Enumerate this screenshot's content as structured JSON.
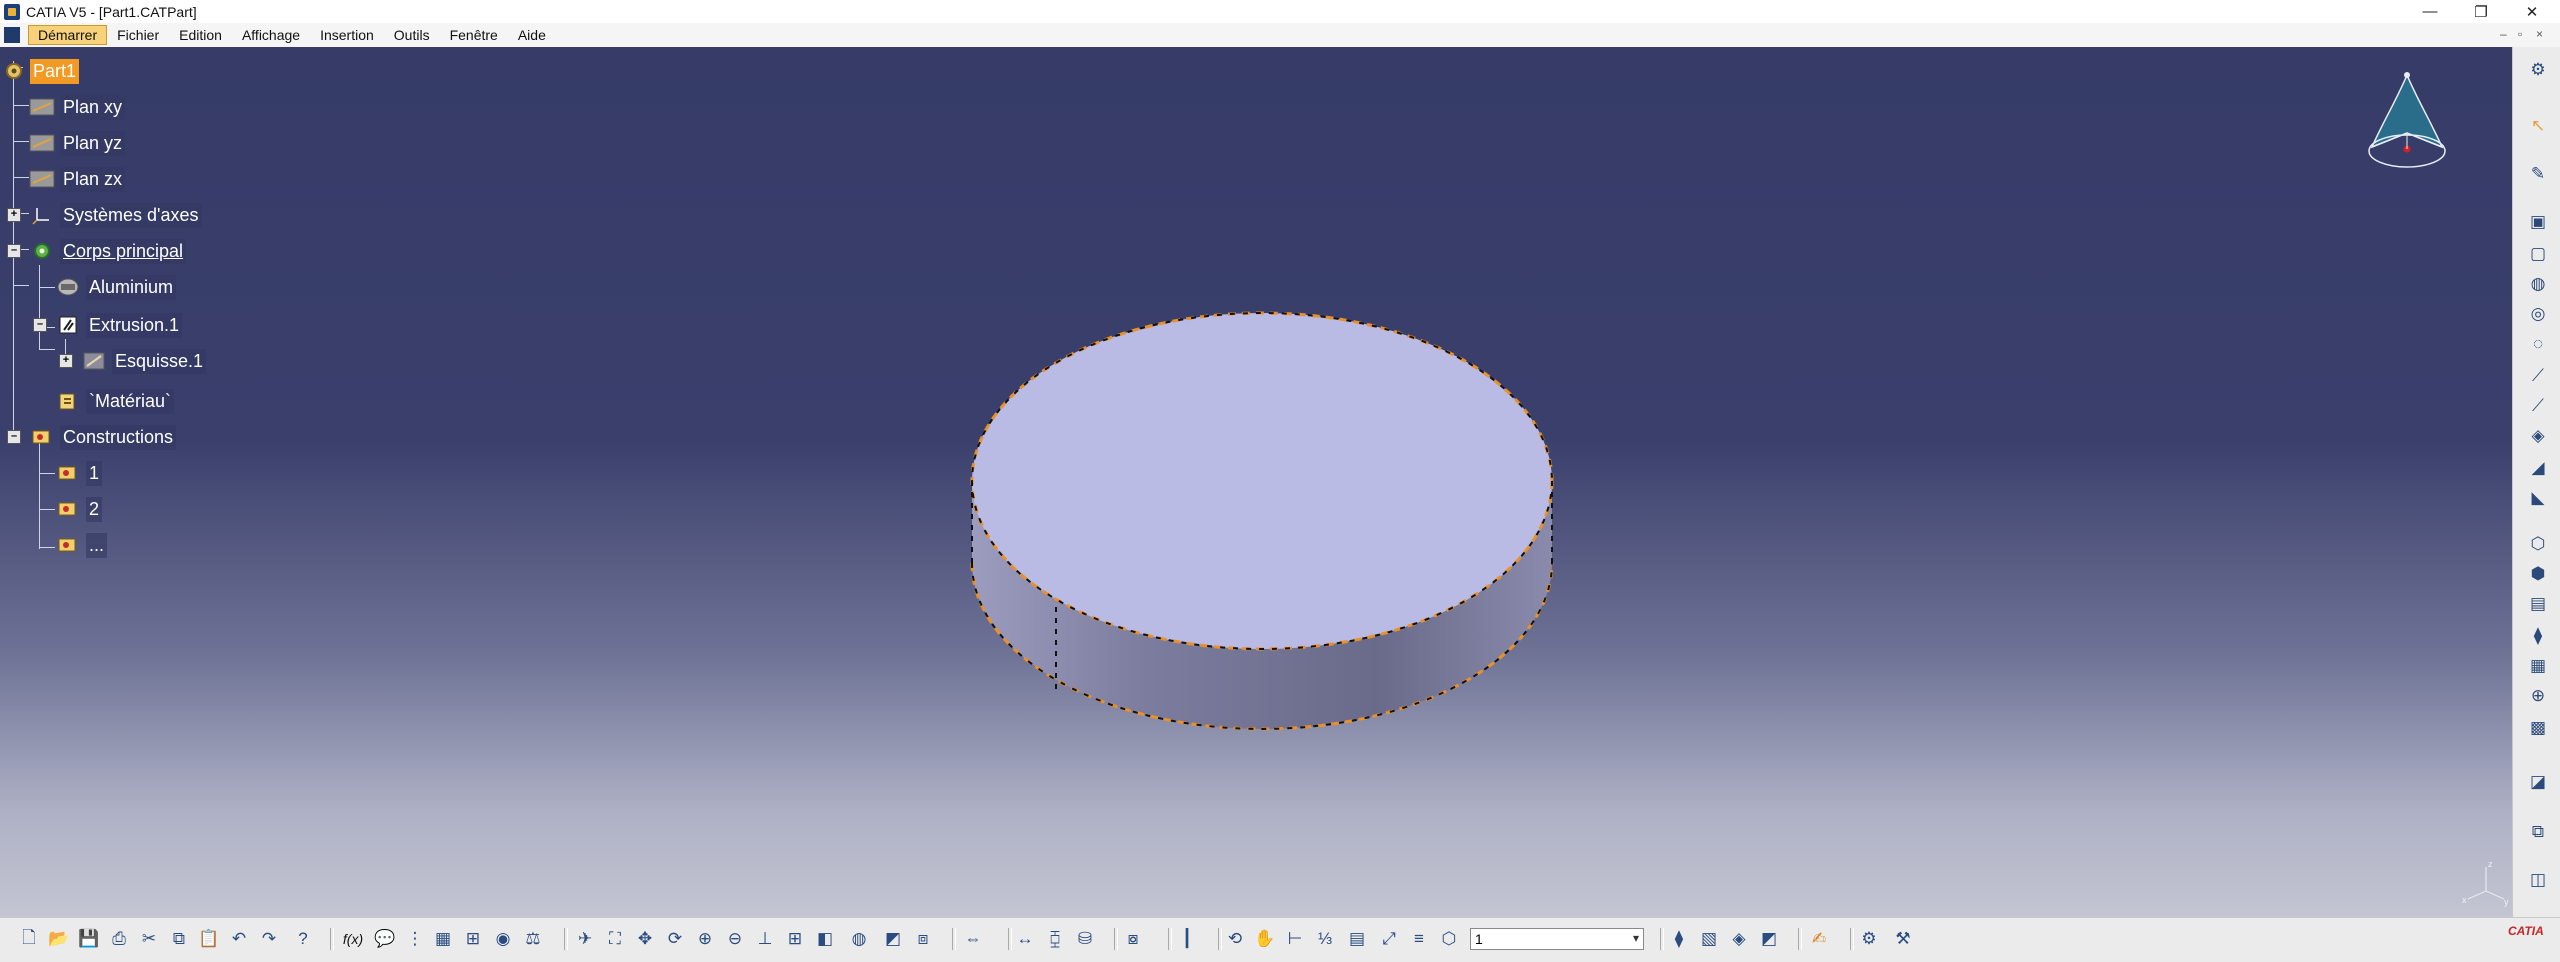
{
  "window": {
    "title": "CATIA V5 - [Part1.CATPart]",
    "minimize": "—",
    "restore": "❐",
    "close": "✕"
  },
  "menu": {
    "items": [
      "Démarrer",
      "Fichier",
      "Edition",
      "Affichage",
      "Insertion",
      "Outils",
      "Fenêtre",
      "Aide"
    ],
    "active_index": 0
  },
  "tree": {
    "root": "Part1",
    "plan_xy": "Plan xy",
    "plan_yz": "Plan yz",
    "plan_zx": "Plan zx",
    "axis_systems": "Systèmes d'axes",
    "main_body": "Corps principal",
    "material": "Aluminium",
    "extrusion": "Extrusion.1",
    "sketch": "Esquisse.1",
    "material_param": "`Matériau`",
    "constructions": "Constructions",
    "construction_items": [
      "1",
      "2",
      "..."
    ]
  },
  "compass": {
    "axis_x": "x",
    "axis_y": "y",
    "axis_z": "z"
  },
  "bottom_toolbar": {
    "layer_value": "1",
    "fx_label": "f(x)"
  },
  "colors": {
    "accent": "#f39a24",
    "viewport_top": "#363b68",
    "viewport_bottom": "#c3c5d2",
    "part_top": "#babbe4",
    "part_side": "#8a8aaa",
    "selection_edge": "#e8902a"
  }
}
